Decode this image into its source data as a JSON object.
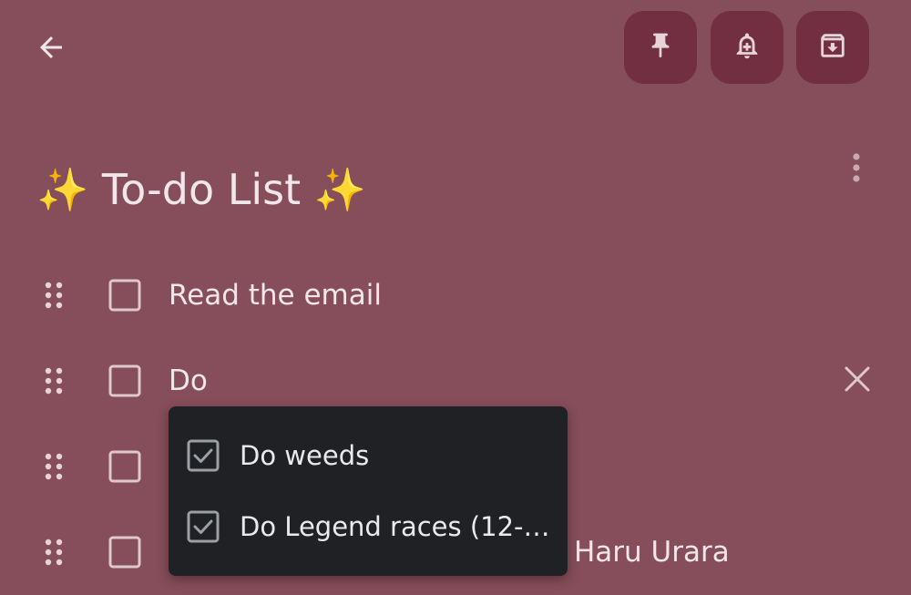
{
  "topbar": {
    "back_icon": "arrow-back-icon",
    "actions": [
      {
        "name": "pin",
        "icon": "pin-icon"
      },
      {
        "name": "reminder",
        "icon": "bell-plus-icon"
      },
      {
        "name": "archive",
        "icon": "archive-icon"
      }
    ],
    "more_icon": "more-vert-icon"
  },
  "note": {
    "title": "✨ To-do List ✨"
  },
  "checklist": {
    "items": [
      {
        "text": "Read the email",
        "checked": false
      },
      {
        "text": "Do",
        "checked": false
      },
      {
        "text": "",
        "checked": false
      },
      {
        "text": "Haru Urara",
        "checked": false
      }
    ]
  },
  "autocomplete": {
    "suggestions": [
      {
        "text": "Do weeds",
        "checked": true
      },
      {
        "text": "Do Legend races (12-…",
        "checked": true
      }
    ]
  },
  "colors": {
    "background": "#864d5a",
    "action_button": "#722f42",
    "text": "#f1e6e9",
    "icon": "#e6d4d9",
    "checkbox_border": "#dcc8cd",
    "popup_bg": "#202124",
    "popup_text": "#e8eaed",
    "popup_checkbox": "#9aa0a6"
  }
}
